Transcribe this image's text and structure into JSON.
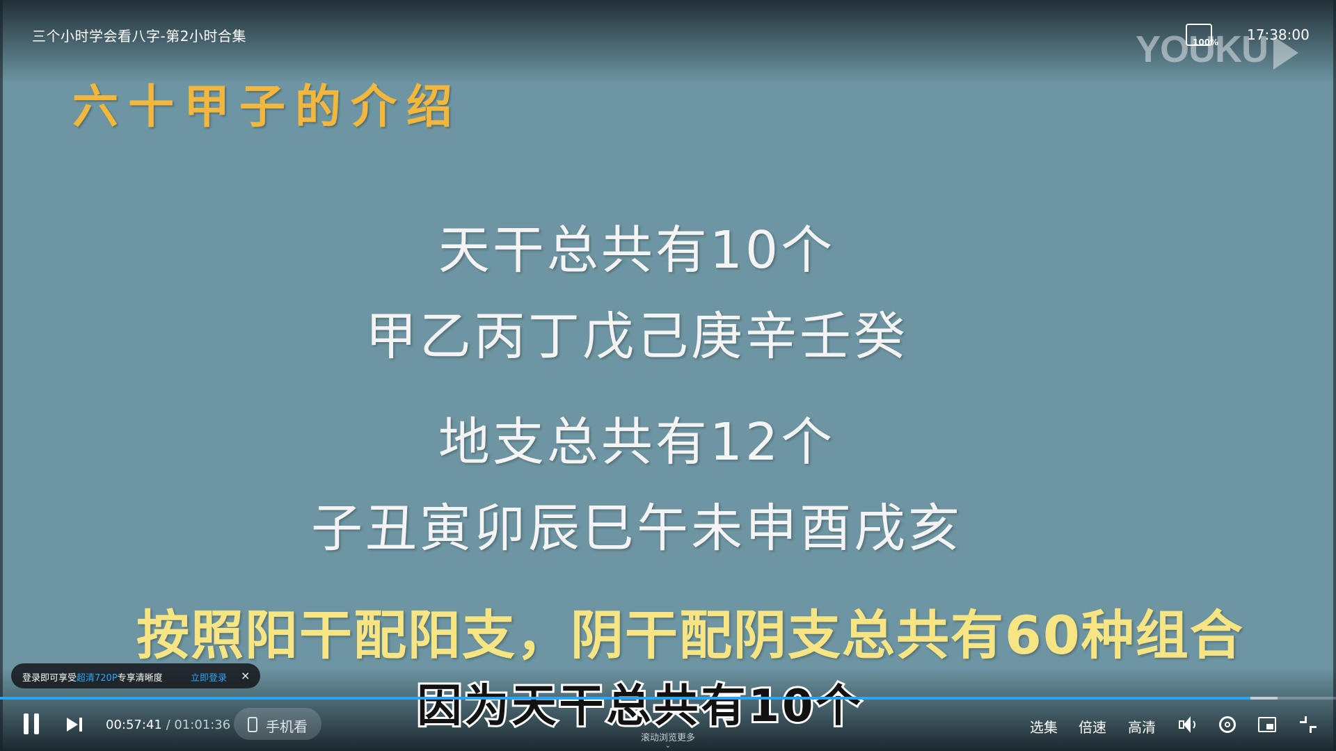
{
  "player": {
    "video_title": "三个小时学会看八字-第2小时合集",
    "clock": "17:38:00",
    "zoom_label": "100%",
    "watermark": "YOUKU"
  },
  "slide": {
    "heading": "六十甲子的介绍",
    "line1": "天干总共有10个",
    "line2": "甲乙丙丁戊己庚辛壬癸",
    "line3": "地支总共有12个",
    "line4": "子丑寅卯辰巳午未申酉戌亥",
    "yellow_line": "按照阳干配阳支，阴干配阴支总共有60种组合"
  },
  "subtitle": "因为天干总共有10个",
  "login_toast": {
    "text_prefix": "登录即可享受",
    "text_highlight": "超清720P",
    "text_suffix": "专享清晰度",
    "link": "立即登录",
    "close": "×"
  },
  "controls": {
    "current_time": "00:57:41",
    "separator": " / ",
    "total_time": "01:01:36",
    "progress_fraction": 0.936,
    "buffered_fraction": 0.956,
    "phone_label": "手机看",
    "scroll_hint": "滚动浏览更多",
    "select_episode": "选集",
    "speed": "倍速",
    "quality": "高清"
  },
  "colors": {
    "accent": "#2aa5f3",
    "heading": "#f2b73c",
    "yellow_line": "#f7e483",
    "slide_bg": "#6d95a2"
  }
}
